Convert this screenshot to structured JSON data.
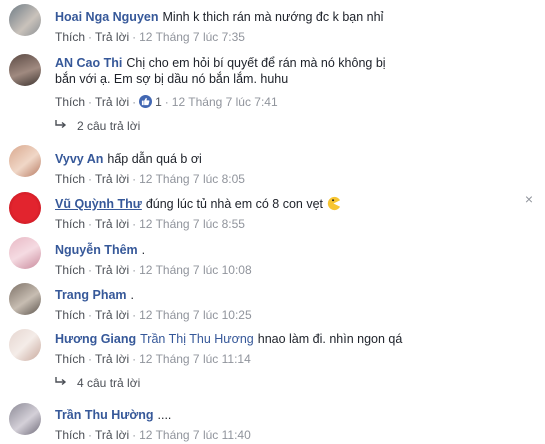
{
  "comments": [
    {
      "author": "Hoai Nga Nguyen",
      "text": "Minh k thich rán mà nướng đc k bạn nhỉ",
      "actions": {
        "like": "Thích",
        "reply": "Trả lời",
        "time": "12 Tháng 7 lúc 7:35"
      }
    },
    {
      "author": "AN Cao Thi",
      "text": "Chị cho em hỏi bí quyết để rán mà nó không bị bắn với ạ. Em sợ bị dầu nó bắn lắm. huhu",
      "actions": {
        "like": "Thích",
        "reply": "Trả lời",
        "likes": "1",
        "time": "12 Tháng 7 lúc 7:41"
      },
      "replies": "2 câu trả lời"
    },
    {
      "author": "Vyvy An",
      "text": "hấp dẫn quá b ơi",
      "actions": {
        "like": "Thích",
        "reply": "Trả lời",
        "time": "12 Tháng 7 lúc 8:05"
      }
    },
    {
      "author": "Vũ Quỳnh Thư",
      "text": "đúng lúc tủ nhà em có 8 con vẹt",
      "actions": {
        "like": "Thích",
        "reply": "Trả lời",
        "time": "12 Tháng 7 lúc 8:55"
      },
      "close": "×"
    },
    {
      "author": "Nguyễn Thêm",
      "text": ".",
      "actions": {
        "like": "Thích",
        "reply": "Trả lời",
        "time": "12 Tháng 7 lúc 10:08"
      }
    },
    {
      "author": "Trang Pham",
      "text": ".",
      "actions": {
        "like": "Thích",
        "reply": "Trả lời",
        "time": "12 Tháng 7 lúc 10:25"
      }
    },
    {
      "author": "Hương Giang",
      "mention": "Trần Thị Thu Hương",
      "text": "hnao làm đi. nhìn ngon qá",
      "actions": {
        "like": "Thích",
        "reply": "Trả lời",
        "time": "12 Tháng 7 lúc 11:14"
      },
      "replies": "4 câu trả lời"
    },
    {
      "author": "Trần Thu Hường",
      "text": "....",
      "actions": {
        "like": "Thích",
        "reply": "Trả lời",
        "time": "12 Tháng 7 lúc 11:40"
      }
    }
  ],
  "colors": {
    "link": "#365899",
    "meta": "#90949c",
    "like_badge": "#4267b2"
  }
}
